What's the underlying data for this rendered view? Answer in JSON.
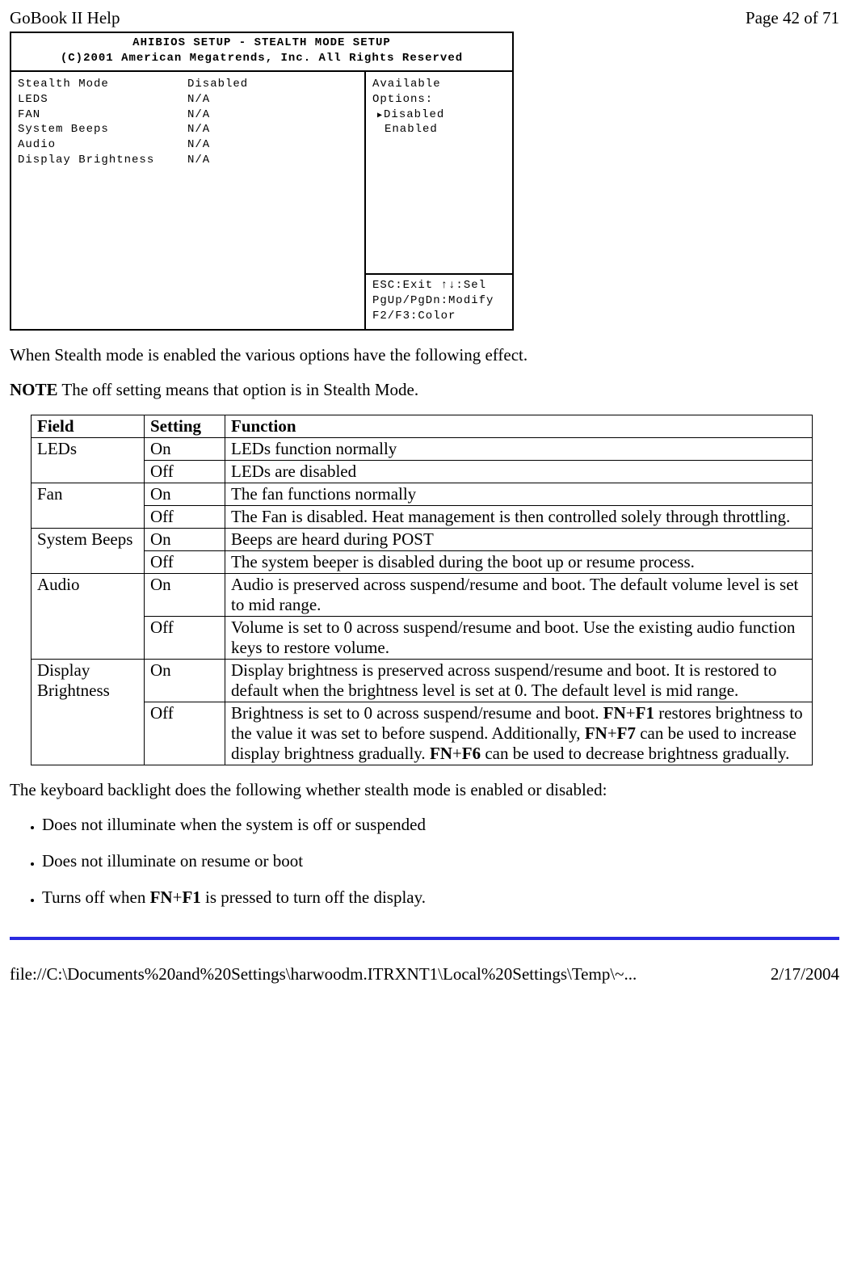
{
  "header": {
    "title": "GoBook II Help",
    "page": "Page 42 of 71"
  },
  "bios": {
    "title1": "AHIBIOS SETUP - STEALTH MODE SETUP",
    "title2": "(C)2001 American Megatrends, Inc. All Rights Reserved",
    "rows": [
      {
        "label": "Stealth Mode",
        "value": "Disabled"
      },
      {
        "label": "LEDS",
        "value": "N/A"
      },
      {
        "label": "FAN",
        "value": "N/A"
      },
      {
        "label": "System Beeps",
        "value": "N/A"
      },
      {
        "label": "Audio",
        "value": "N/A"
      },
      {
        "label": "Display Brightness",
        "value": "N/A"
      }
    ],
    "options_title": "Available Options:",
    "option_selected": "Disabled",
    "option_other": "Enabled",
    "help1": "ESC:Exit  ↑↓:Sel",
    "help2": "PgUp/PgDn:Modify",
    "help3": "F2/F3:Color"
  },
  "body": {
    "p1": "When Stealth mode is enabled the various options have the following effect.",
    "note_label": "NOTE",
    "note_text": "  The off setting means that option is in Stealth Mode."
  },
  "table": {
    "h_field": "Field",
    "h_setting": "Setting",
    "h_function": "Function",
    "leds_label": "LEDs",
    "leds_on_s": "On",
    "leds_on_f": "LEDs function normally",
    "leds_off_s": "Off",
    "leds_off_f": "LEDs are disabled",
    "fan_label": "Fan",
    "fan_on_s": "On",
    "fan_on_f": "The fan functions normally",
    "fan_off_s": "Off",
    "fan_off_f": "The Fan is disabled.  Heat management is then controlled solely through throttling.",
    "beeps_label": "System Beeps",
    "beeps_on_s": "On",
    "beeps_on_f": "Beeps are heard during POST",
    "beeps_off_s": "Off",
    "beeps_off_f": "The system beeper is disabled during the boot up or resume process.",
    "audio_label": "Audio",
    "audio_on_s": "On",
    "audio_on_f": "Audio is preserved across suspend/resume and boot.  The default volume level is set to mid range.",
    "audio_off_s": "Off",
    "audio_off_f": "Volume is set to 0 across suspend/resume and boot.  Use the existing audio function keys to restore volume.",
    "disp_label": "Display Brightness",
    "disp_on_s": "On",
    "disp_on_f": "Display brightness is preserved across suspend/resume and boot.  It is restored to default when the brightness level is set at 0.  The default level is mid range.",
    "disp_off_s": "Off",
    "disp_off_pre": "Brightness is set to 0 across suspend/resume and boot.  ",
    "disp_off_fn1a": "FN",
    "disp_off_fn1b": "F1",
    "disp_off_mid1": " restores brightness to the value it was set to before suspend.  Additionally, ",
    "disp_off_fn7a": "FN",
    "disp_off_fn7b": "F7",
    "disp_off_mid2": " can be used to increase display brightness gradually.  ",
    "disp_off_fn6a": "FN",
    "disp_off_fn6b": "F6",
    "disp_off_post": " can be used to decrease brightness gradually."
  },
  "kb_intro": "The keyboard backlight does the following whether stealth mode is enabled or disabled:",
  "kb": {
    "li1": "Does not illuminate when the system is off or suspended",
    "li2": "Does not illuminate on resume or boot",
    "li3_pre": "Turns off when ",
    "li3_fn": "FN",
    "li3_plus": "+",
    "li3_f1": "F1",
    "li3_post": " is pressed to turn off the display."
  },
  "footer": {
    "path": "file://C:\\Documents%20and%20Settings\\harwoodm.ITRXNT1\\Local%20Settings\\Temp\\~...",
    "date": "2/17/2004"
  }
}
